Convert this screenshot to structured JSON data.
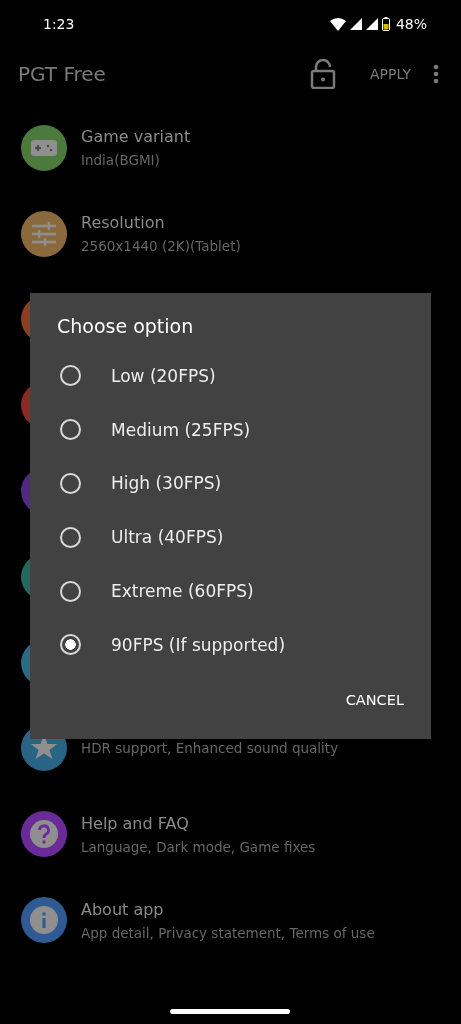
{
  "status_bar": {
    "time": "1:23",
    "battery": "48%"
  },
  "app_bar": {
    "title": "PGT Free",
    "action": "APPLY"
  },
  "settings": [
    {
      "kind": "gamepad",
      "color": "#4c7a3c",
      "title": "Game variant",
      "subtitle": "India(BGMI)"
    },
    {
      "kind": "sliders",
      "color": "#8a6a3c",
      "title": "Resolution",
      "subtitle": "2560x1440 (2K)(Tablet)"
    },
    {
      "kind": "plain",
      "color": "#8c3e22"
    },
    {
      "kind": "plain",
      "color": "#8a2a24"
    },
    {
      "kind": "plain",
      "color": "#4e2a86"
    },
    {
      "kind": "plain",
      "color": "#1f6a5c"
    },
    {
      "kind": "plain",
      "color": "#2a6a82"
    },
    {
      "kind": "star",
      "color": "#2a6484",
      "subtitle": "HDR support, Enhanced sound quality"
    },
    {
      "kind": "question",
      "color": "#6a2a98",
      "title": "Help and FAQ",
      "subtitle": "Language, Dark mode, Game fixes"
    },
    {
      "kind": "info",
      "color": "#2f5a94",
      "title": "About app",
      "subtitle": "App detail, Privacy statement, Terms of use"
    }
  ],
  "dialog": {
    "title": "Choose option",
    "options": [
      {
        "label": "Low (20FPS)",
        "selected": false
      },
      {
        "label": "Medium (25FPS)",
        "selected": false
      },
      {
        "label": "High (30FPS)",
        "selected": false
      },
      {
        "label": "Ultra (40FPS)",
        "selected": false
      },
      {
        "label": "Extreme (60FPS)",
        "selected": false
      },
      {
        "label": "90FPS (If supported)",
        "selected": true
      }
    ],
    "button": "CANCEL"
  }
}
